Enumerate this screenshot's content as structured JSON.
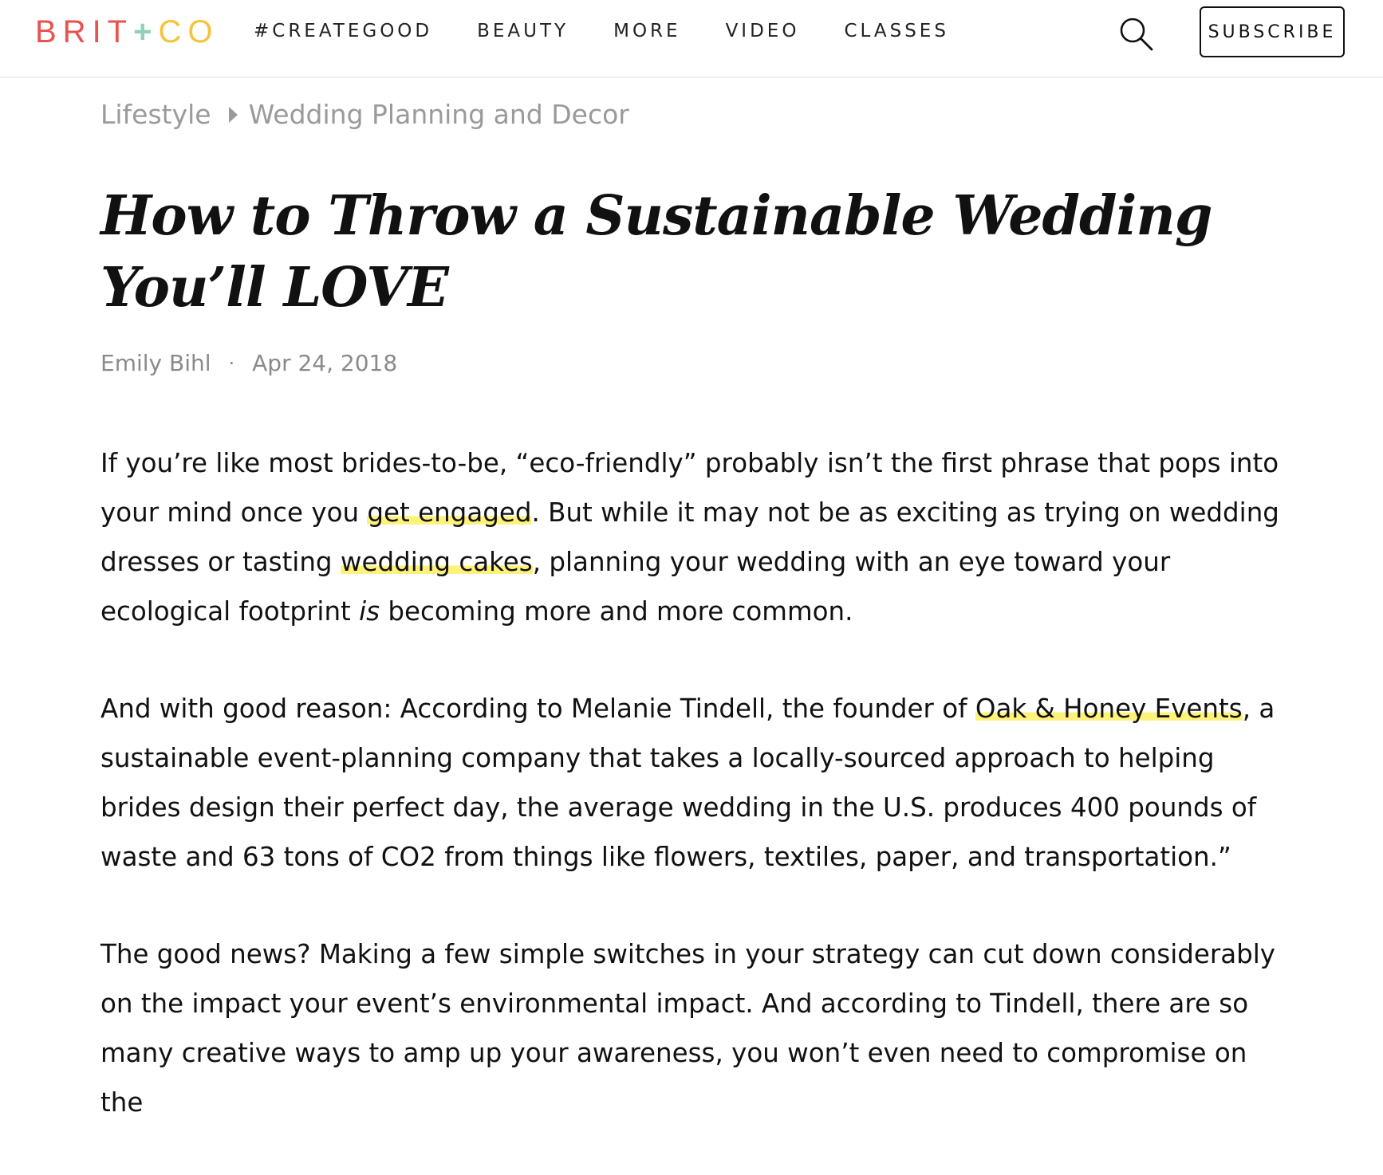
{
  "header": {
    "logo": {
      "part1": "BRIT",
      "plus": "+",
      "part2": "CO"
    },
    "nav": [
      "#CREATEGOOD",
      "BEAUTY",
      "MORE",
      "VIDEO",
      "CLASSES"
    ],
    "search_icon": "search-icon",
    "subscribe_label": "SUBSCRIBE"
  },
  "breadcrumb": {
    "items": [
      "Lifestyle",
      "Wedding Planning and Decor"
    ]
  },
  "article": {
    "title": "How to Throw a Sustainable Wedding You’ll LOVE",
    "author": "Emily Bihl",
    "separator": "·",
    "date": "Apr 24, 2018",
    "paragraphs": [
      {
        "t1": "If you’re like most brides-to-be, “eco-friendly” probably isn’t the first phrase that pops into your mind once you ",
        "link1": "get engaged",
        "t2": ". But while it may not be as exciting as trying on wedding dresses or tasting ",
        "link2": "wedding cakes",
        "t3": ", planning your wedding with an eye toward your ecological footprint ",
        "em": "is",
        "t4": " becoming more and more common."
      },
      {
        "t1": "And with good reason: According to Melanie Tindell, the founder of ",
        "link1": "Oak & Honey Events",
        "t2": ", a sustainable event-planning company that takes a locally-sourced approach to helping brides design their perfect day, the average wedding in the U.S. produces 400 pounds of waste and 63 tons of CO2 from things like flowers, textiles, paper, and transportation.”"
      },
      {
        "t1": "The good news? Making a few simple switches in your strategy can cut down considerably on the impact your event’s environmental impact. And according to Tindell, there are so many creative ways to amp up your awareness, you won’t even need to compromise on the"
      }
    ]
  },
  "colors": {
    "logo_red": "#e8524f",
    "logo_green": "#8fd3b5",
    "logo_yellow": "#f5c43c",
    "link_highlight": "#fff27a",
    "muted_text": "#9a9a9a"
  }
}
